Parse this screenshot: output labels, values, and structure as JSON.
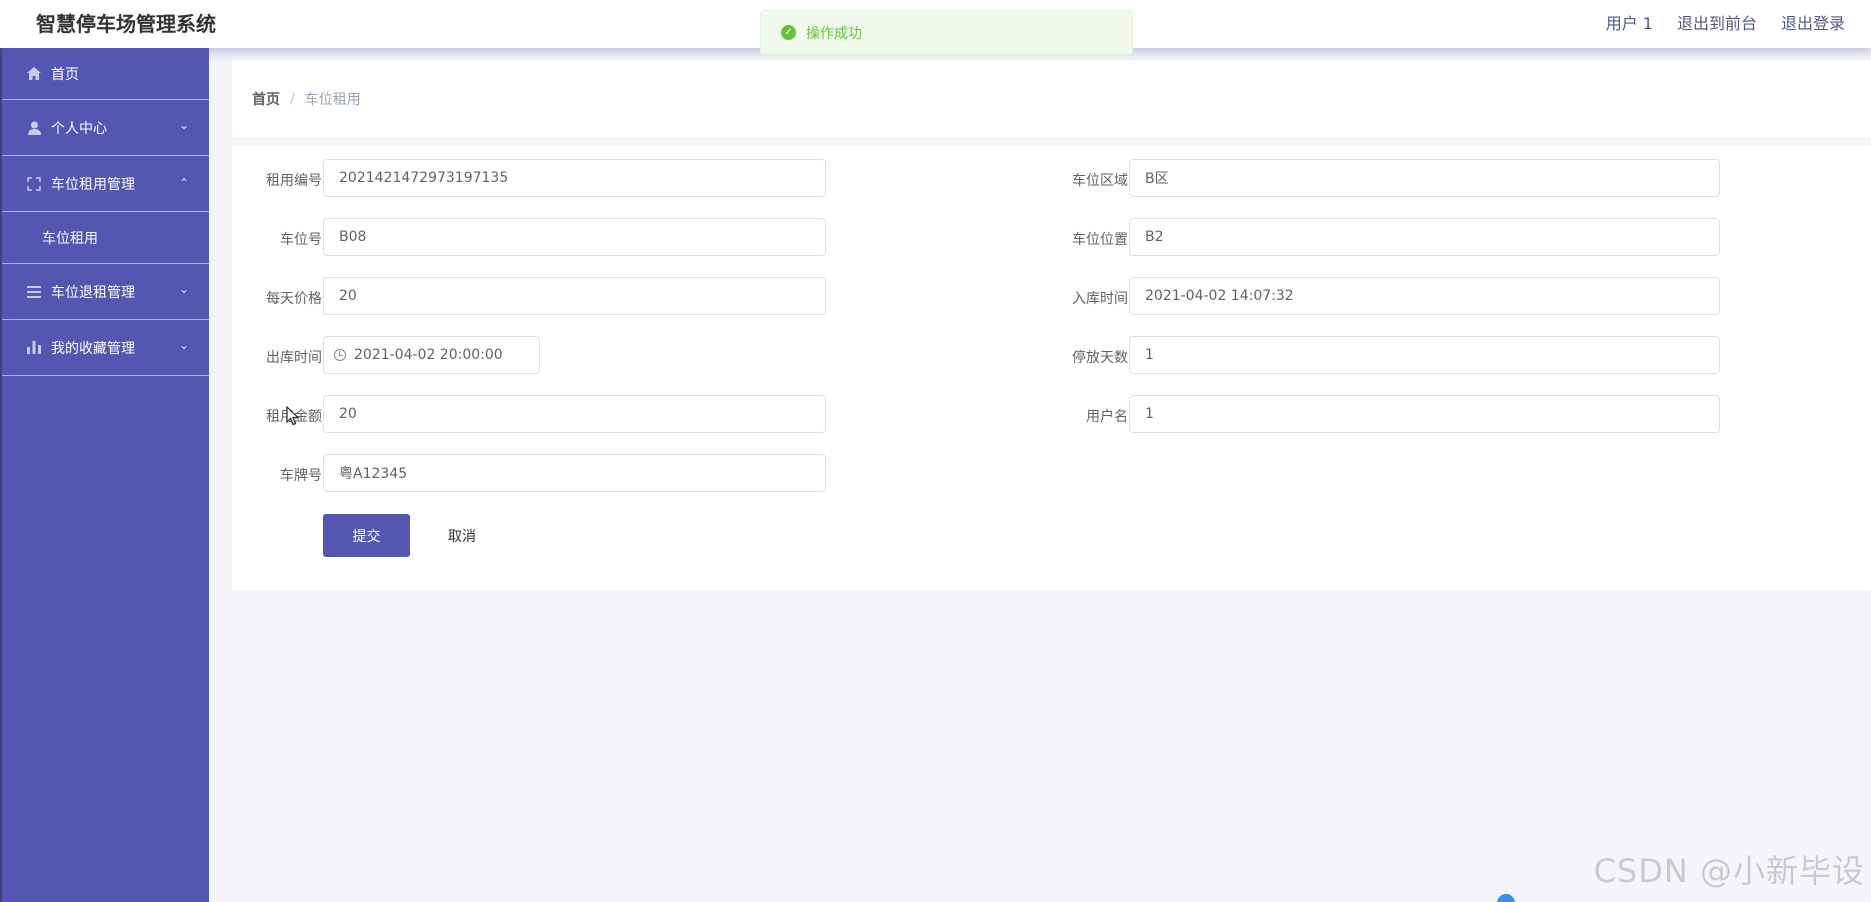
{
  "header": {
    "title": "智慧停车场管理系统",
    "user": "用户 1",
    "front_link": "退出到前台",
    "logout_link": "退出登录"
  },
  "toast": {
    "message": "操作成功"
  },
  "sidebar": {
    "items": [
      {
        "label": "首页",
        "icon": "home-icon"
      },
      {
        "label": "个人中心",
        "icon": "user-icon"
      },
      {
        "label": "车位租用管理",
        "icon": "fullscreen-icon",
        "expanded": true
      },
      {
        "label": "车位租用"
      },
      {
        "label": "车位退租管理",
        "icon": "list-icon"
      },
      {
        "label": "我的收藏管理",
        "icon": "bar-chart-icon"
      }
    ]
  },
  "breadcrumb": {
    "home": "首页",
    "separator": "/",
    "current": "车位租用"
  },
  "form": {
    "rental_no_label": "租用编号",
    "rental_no": "2021421472973197135",
    "area_label": "车位区域",
    "area": "B区",
    "spot_no_label": "车位号",
    "spot_no": "B08",
    "location_label": "车位位置",
    "location": "B2",
    "daily_price_label": "每天价格",
    "daily_price": "20",
    "entry_time_label": "入库时间",
    "entry_time": "2021-04-02 14:07:32",
    "exit_time_label": "出库时间",
    "exit_time": "2021-04-02 20:00:00",
    "days_label": "停放天数",
    "days": "1",
    "amount_label": "租用金额",
    "amount": "20",
    "username_label": "用户名",
    "username": "1",
    "plate_label": "车牌号",
    "plate": "粤A12345",
    "submit": "提交",
    "cancel": "取消"
  },
  "watermark": "CSDN @小新毕设",
  "colors": {
    "primary": "#5457b1",
    "success": "#67c23a"
  }
}
